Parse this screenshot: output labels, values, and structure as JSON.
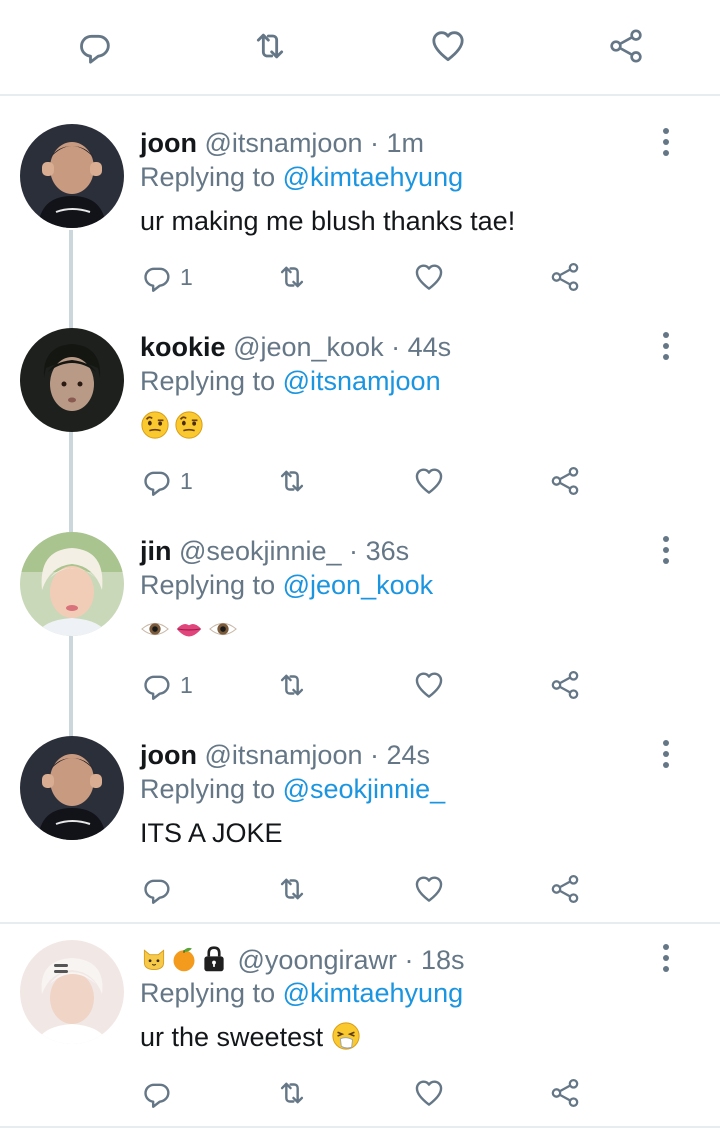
{
  "top_actions": {
    "icons": [
      "reply-icon",
      "retweet-icon",
      "like-icon",
      "share-icon"
    ]
  },
  "colors": {
    "text": "#14171a",
    "secondary": "#657786",
    "mention": "#1b95e0",
    "icon": "#657786",
    "thread_line": "#ccd6dd"
  },
  "tweets": [
    {
      "name": "joon",
      "handle": "@itsnamjoon",
      "separator": "·",
      "time": "1m",
      "replying_label": "Replying to",
      "replying_to": "@kimtaehyung",
      "text": "ur making me blush thanks tae!",
      "reply_count": "1"
    },
    {
      "name": "kookie",
      "handle": "@jeon_kook",
      "separator": "·",
      "time": "44s",
      "replying_label": "Replying to",
      "replying_to": "@itsnamjoon",
      "text": "",
      "emojis": [
        "face-with-raised-eyebrow",
        "face-with-raised-eyebrow"
      ],
      "reply_count": "1"
    },
    {
      "name": "jin",
      "handle": "@seokjinnie_",
      "separator": "·",
      "time": "36s",
      "replying_label": "Replying to",
      "replying_to": "@jeon_kook",
      "text": "",
      "emojis": [
        "eye",
        "lips",
        "eye"
      ],
      "reply_count": "1"
    },
    {
      "name": "joon",
      "handle": "@itsnamjoon",
      "separator": "·",
      "time": "24s",
      "replying_label": "Replying to",
      "replying_to": "@seokjinnie_",
      "text": "ITS A JOKE",
      "reply_count": ""
    },
    {
      "name": "",
      "name_emojis": [
        "cat-face",
        "tangerine",
        "lock"
      ],
      "handle": "@yoongirawr",
      "separator": "·",
      "time": "18s",
      "replying_label": "Replying to",
      "replying_to": "@kimtaehyung",
      "text": "ur the sweetest",
      "trailing_emoji": "sneezing-face",
      "reply_count": ""
    }
  ]
}
